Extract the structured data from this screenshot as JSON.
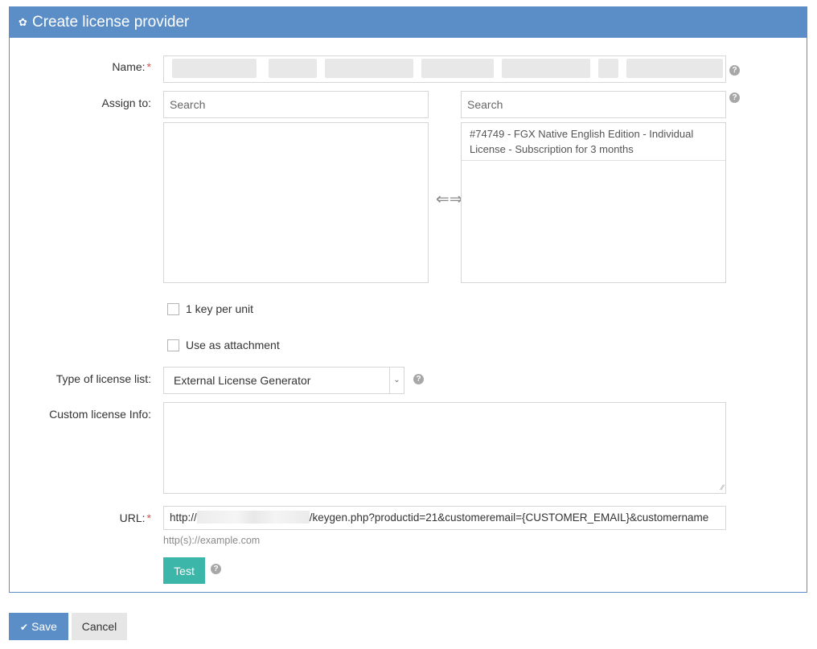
{
  "header": {
    "gear_icon": "gear-icon",
    "title": "Create license provider"
  },
  "form": {
    "name": {
      "label": "Name:",
      "required_mark": "*",
      "value": ""
    },
    "assign_to": {
      "label": "Assign to:",
      "available_search_placeholder": "Search",
      "selected_search_placeholder": "Search",
      "available_items": [],
      "selected_items": [
        "#74749 - FGX Native English Edition - Individual License - Subscription for 3 months"
      ],
      "swap_icon": "⇐⇒"
    },
    "one_key_per_unit": {
      "label": "1 key per unit",
      "checked": false
    },
    "use_as_attachment": {
      "label": "Use as attachment",
      "checked": false
    },
    "license_type": {
      "label": "Type of license list:",
      "selected": "External License Generator"
    },
    "custom_info": {
      "label": "Custom license Info:",
      "value": ""
    },
    "url": {
      "label": "URL:",
      "required_mark": "*",
      "prefix": "http://",
      "value_after_blur": "/keygen.php?productid=21&customeremail={CUSTOMER_EMAIL}&customername",
      "hint": "http(s)://example.com"
    },
    "help_icon": "?",
    "test_button": "Test"
  },
  "footer": {
    "save_label": "Save",
    "save_icon": "✔",
    "cancel_label": "Cancel"
  }
}
